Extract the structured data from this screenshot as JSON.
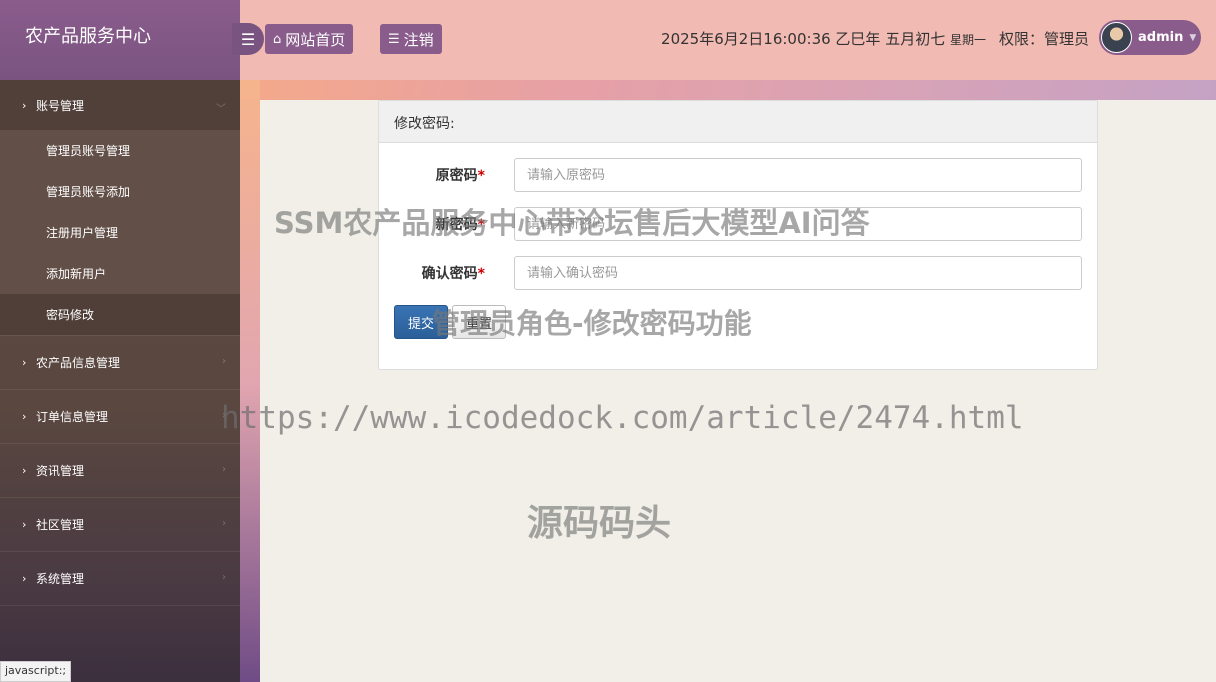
{
  "brand": {
    "title": "农产品服务中心"
  },
  "header": {
    "toggle_icon": "menu-icon",
    "home_label": "网站首页",
    "logout_label": "注销",
    "datetime": "2025年6月2日16:00:36 乙巳年 五月初七",
    "weekday": "星期一",
    "role_text": "权限：管理员",
    "username": "admin"
  },
  "sidebar": {
    "groups": [
      {
        "label": "账号管理",
        "open": true,
        "items": [
          {
            "label": "管理员账号管理"
          },
          {
            "label": "管理员账号添加"
          },
          {
            "label": "注册用户管理"
          },
          {
            "label": "添加新用户"
          },
          {
            "label": "密码修改",
            "active": true
          }
        ]
      },
      {
        "label": "农产品信息管理"
      },
      {
        "label": "订单信息管理"
      },
      {
        "label": "资讯管理"
      },
      {
        "label": "社区管理"
      },
      {
        "label": "系统管理"
      }
    ]
  },
  "status_tip": "javascript:;",
  "form": {
    "title": "修改密码:",
    "fields": [
      {
        "label": "原密码",
        "required": "*",
        "placeholder": "请输入原密码"
      },
      {
        "label": "新密码",
        "required": "*",
        "placeholder": "请输入新密码"
      },
      {
        "label": "确认密码",
        "required": "*",
        "placeholder": "请输入确认密码"
      }
    ],
    "submit_label": "提交",
    "reset_label": "重置"
  },
  "watermarks": {
    "line1": "SSM农产品服务中心带论坛售后大模型AI问答",
    "line2": "管理员角色-修改密码功能",
    "line3": "https://www.icodedock.com/article/2474.html",
    "line4": "源码码头"
  },
  "colors": {
    "sidebar_brand": "#7a5480",
    "header_bg": "#f1bab2",
    "button_accent": "#8a5c8c",
    "submit_blue": "#2a5f99"
  }
}
